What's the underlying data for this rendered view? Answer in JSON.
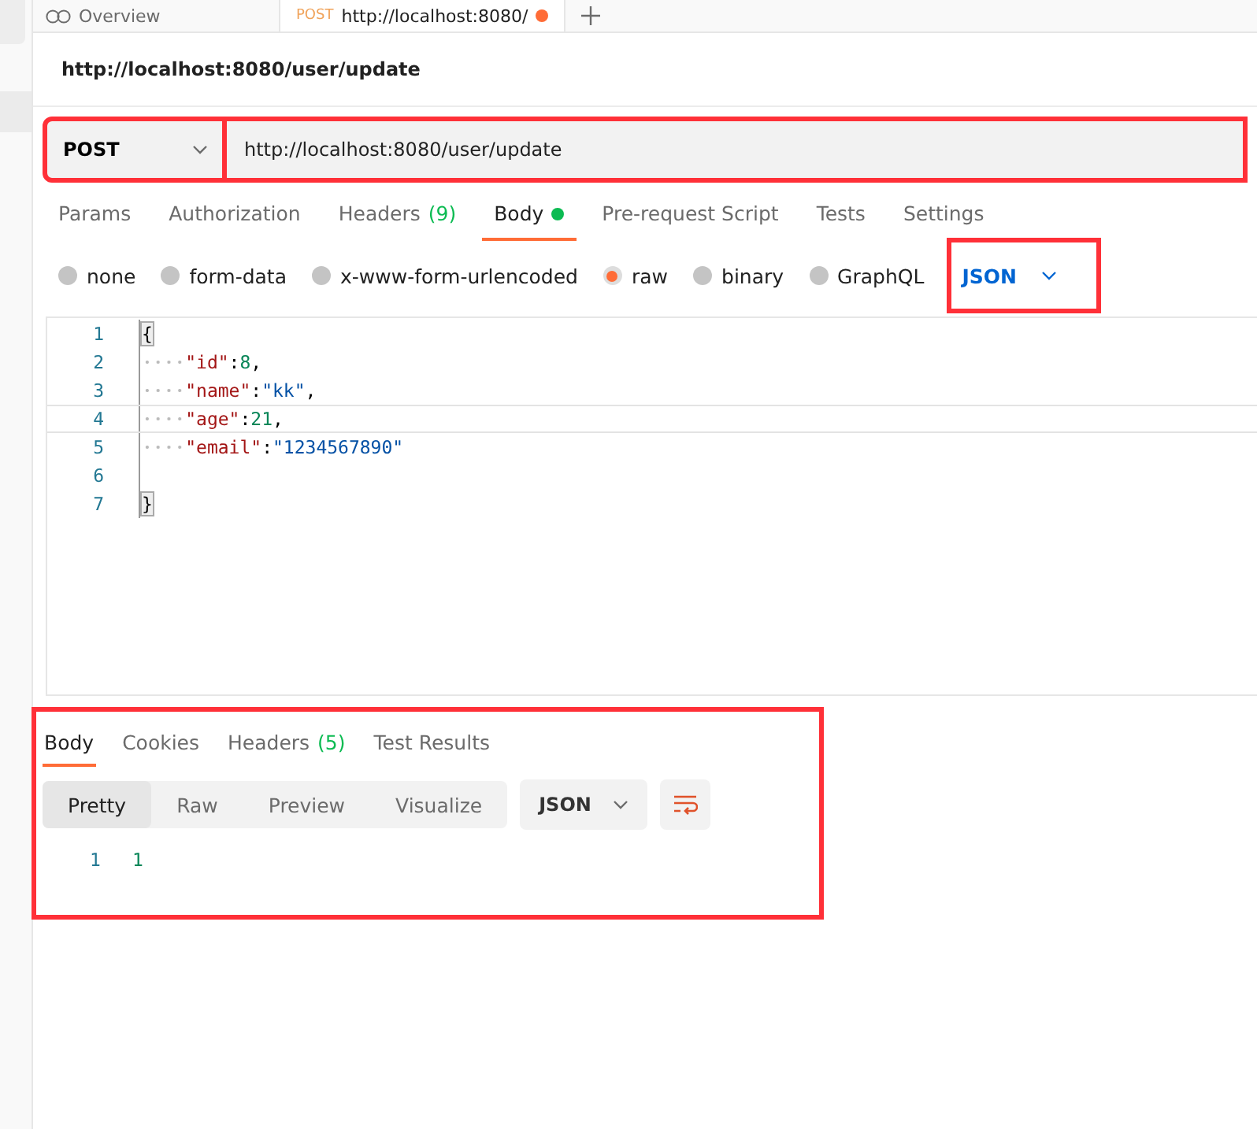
{
  "top_tabs": [
    {
      "label": "Overview",
      "selected": false,
      "unsaved": false
    },
    {
      "method": "POST",
      "label": "http://localhost:8080/",
      "selected": true,
      "unsaved": true
    }
  ],
  "request_title": "http://localhost:8080/user/update",
  "request": {
    "method": "POST",
    "method_highlighted": true,
    "url": "http://localhost:8080/user/update",
    "url_highlighted": true
  },
  "request_tabs": [
    {
      "label": "Params",
      "selected": false,
      "dot": false
    },
    {
      "label": "Authorization",
      "selected": false,
      "dot": false
    },
    {
      "label": "Headers",
      "count": "(9)",
      "selected": false,
      "dot": false
    },
    {
      "label": "Body",
      "selected": true,
      "dot": true
    },
    {
      "label": "Pre-request Script",
      "selected": false,
      "dot": false
    },
    {
      "label": "Tests",
      "selected": false,
      "dot": false
    },
    {
      "label": "Settings",
      "selected": false,
      "dot": false
    }
  ],
  "body_types": [
    {
      "label": "none",
      "selected": false
    },
    {
      "label": "form-data",
      "selected": false
    },
    {
      "label": "x-www-form-urlencoded",
      "selected": false
    },
    {
      "label": "raw",
      "selected": true
    },
    {
      "label": "binary",
      "selected": false
    },
    {
      "label": "GraphQL",
      "selected": false
    }
  ],
  "body_format": {
    "label": "JSON",
    "highlighted": true
  },
  "editor_lines": [
    {
      "number": "1",
      "text": "{"
    },
    {
      "number": "2",
      "text": "    \"id\":8,"
    },
    {
      "number": "3",
      "text": "    \"name\":\"kk\","
    },
    {
      "number": "4",
      "text": "    \"age\":21,"
    },
    {
      "number": "5",
      "text": "    \"email\":\"1234567890\""
    },
    {
      "number": "6"
    },
    {
      "number": "7",
      "text": "}"
    }
  ],
  "response": {
    "highlighted": true,
    "tabs": [
      {
        "label": "Body",
        "selected": true
      },
      {
        "label": "Cookies",
        "selected": false
      },
      {
        "label": "Headers",
        "count": "(5)",
        "selected": false
      },
      {
        "label": "Test Results",
        "selected": false
      }
    ],
    "views": [
      {
        "label": "Pretty",
        "selected": true
      },
      {
        "label": "Raw",
        "selected": false
      },
      {
        "label": "Preview",
        "selected": false
      },
      {
        "label": "Visualize",
        "selected": false
      }
    ],
    "format": "JSON",
    "lines": [
      {
        "number": "1",
        "text": "1"
      }
    ]
  }
}
